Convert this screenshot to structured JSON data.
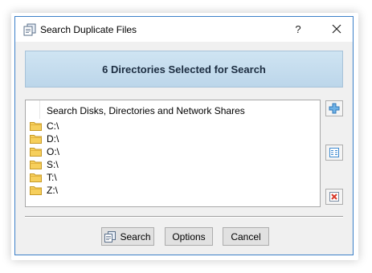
{
  "window": {
    "title": "Search Duplicate Files",
    "help_label": "?",
    "title_bar_color": "#ffffff",
    "border_color": "#3c80c8"
  },
  "header": {
    "text": "6 Directories Selected for Search",
    "background_color": "#c5ddef"
  },
  "directory_list": {
    "column_header": "Search Disks, Directories and Network Shares",
    "items": [
      {
        "label": "C:\\",
        "icon": "folder-icon"
      },
      {
        "label": "D:\\",
        "icon": "folder-icon"
      },
      {
        "label": "O:\\",
        "icon": "folder-icon"
      },
      {
        "label": "S:\\",
        "icon": "folder-icon"
      },
      {
        "label": "T:\\",
        "icon": "folder-icon"
      },
      {
        "label": "Z:\\",
        "icon": "folder-icon"
      }
    ]
  },
  "side_buttons": [
    {
      "icon": "plus-icon"
    },
    {
      "icon": "edit-list-icon"
    },
    {
      "icon": "remove-icon"
    }
  ],
  "footer": {
    "search_label": "Search",
    "options_label": "Options",
    "cancel_label": "Cancel"
  }
}
